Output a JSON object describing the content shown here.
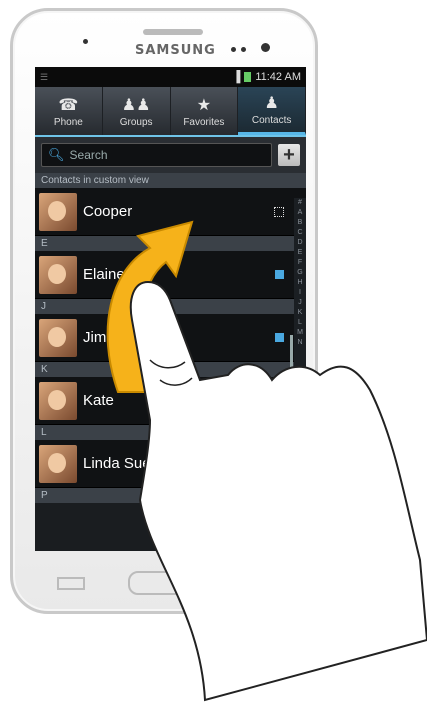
{
  "device": {
    "brand": "SAMSUNG"
  },
  "status_bar": {
    "time": "11:42 AM"
  },
  "tabs": [
    {
      "label": "Phone",
      "icon": "phone-icon"
    },
    {
      "label": "Groups",
      "icon": "groups-icon"
    },
    {
      "label": "Favorites",
      "icon": "star-icon"
    },
    {
      "label": "Contacts",
      "icon": "contact-icon",
      "active": true
    }
  ],
  "search": {
    "placeholder": "Search"
  },
  "list_header": "Contacts in custom view",
  "contacts": [
    {
      "section": "",
      "name": "Cooper"
    },
    {
      "section": "E",
      "name": "Elaine"
    },
    {
      "section": "J",
      "name": "Jim"
    },
    {
      "section": "K",
      "name": "Kate"
    },
    {
      "section": "L",
      "name": "Linda Sue"
    }
  ],
  "next_section": "P",
  "alphabet": [
    "#",
    "A",
    "B",
    "C",
    "D",
    "E",
    "F",
    "G",
    "H",
    "I",
    "J",
    "K",
    "L",
    "M",
    "N"
  ]
}
